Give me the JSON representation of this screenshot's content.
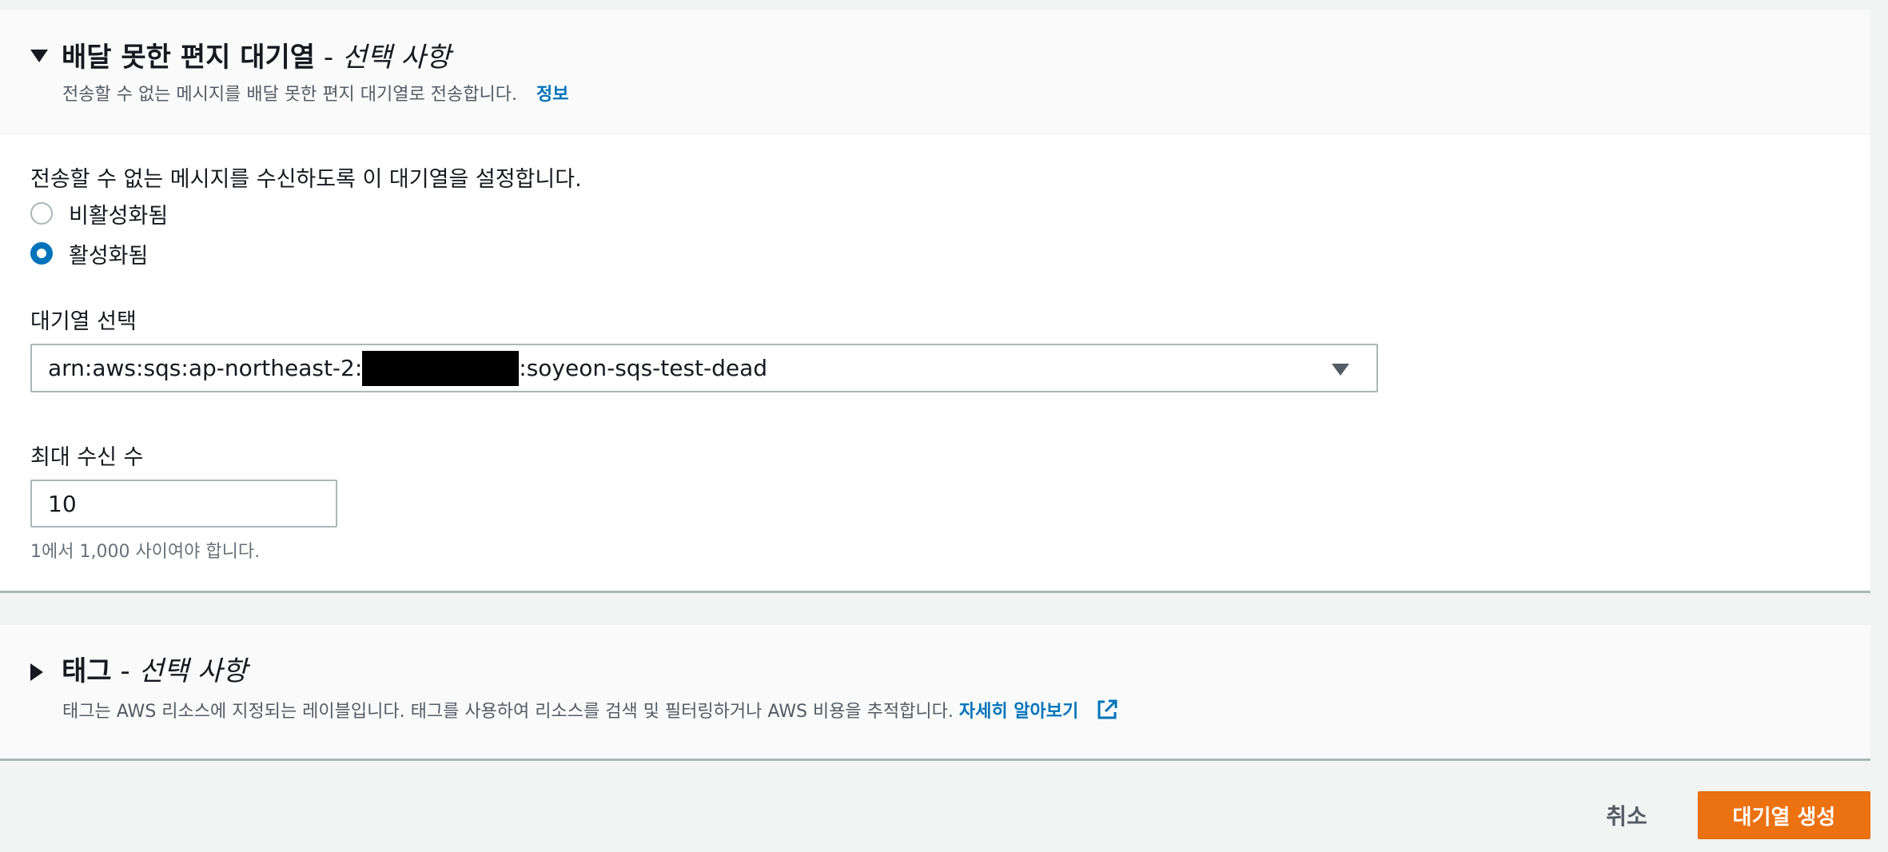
{
  "dlq": {
    "title": "배달 못한 편지 대기열",
    "title_separator": " - ",
    "title_optional": "선택 사항",
    "description": "전송할 수 없는 메시지를 배달 못한 편지 대기열로 전송합니다.",
    "info_link": "정보",
    "setup_label": "전송할 수 없는 메시지를 수신하도록 이 대기열을 설정합니다.",
    "radio_disabled": "비활성화됨",
    "radio_enabled": "활성화됨",
    "selected_option": "enabled",
    "queue_select_label": "대기열 선택",
    "queue_arn_prefix": "arn:aws:sqs:ap-northeast-2:",
    "queue_arn_suffix": ":soyeon-sqs-test-dead",
    "max_receive_label": "최대 수신 수",
    "max_receive_value": "10",
    "max_receive_hint": "1에서 1,000 사이여야 합니다."
  },
  "tags": {
    "title": "태그",
    "title_separator": " - ",
    "title_optional": "선택 사항",
    "description": "태그는 AWS 리소스에 지정되는 레이블입니다. 태그를 사용하여 리소스를 검색 및 필터링하거나 AWS 비용을 추적합니다.",
    "learn_more_link": "자세히 알아보기"
  },
  "footer": {
    "cancel_label": "취소",
    "create_label": "대기열 생성"
  },
  "colors": {
    "link": "#0073bb",
    "primary_button": "#ec7211",
    "radio_selected": "#0073bb"
  },
  "icons": {
    "expanded": "caret-down-icon",
    "collapsed": "caret-right-icon",
    "external": "external-link-icon",
    "dropdown": "chevron-down-icon"
  }
}
